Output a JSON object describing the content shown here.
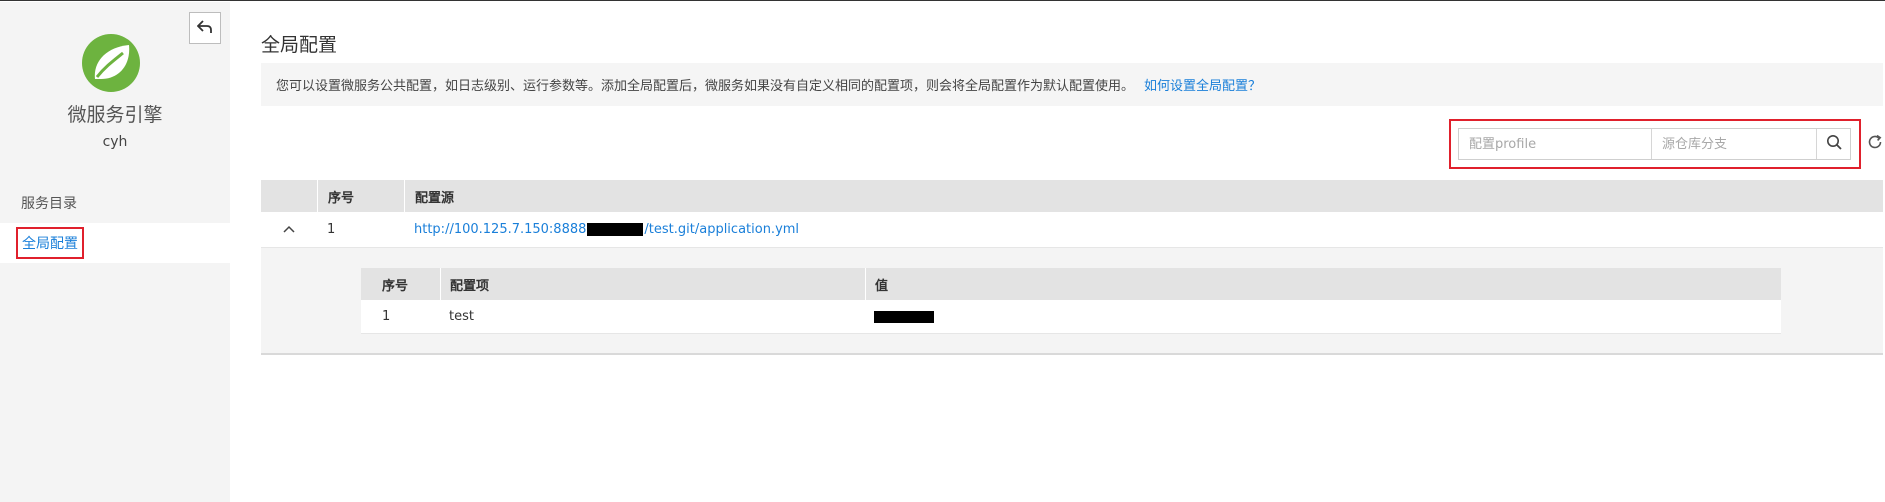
{
  "sidebar": {
    "app_name": "微服务引擎",
    "user": "cyh",
    "nav": [
      {
        "label": "服务目录"
      },
      {
        "label": "全局配置"
      }
    ]
  },
  "main": {
    "title": "全局配置",
    "info_text": "您可以设置微服务公共配置，如日志级别、运行参数等。添加全局配置后，微服务如果没有自定义相同的配置项，则会将全局配置作为默认配置使用。",
    "help_link": "如何设置全局配置？",
    "filter": {
      "profile_placeholder": "配置profile",
      "branch_placeholder": "源仓库分支"
    },
    "table": {
      "headers": [
        "序号",
        "配置源"
      ],
      "rows": [
        {
          "index": "1",
          "source_prefix": "http://100.125.7.150:8888",
          "source_suffix": "/test.git/application.yml"
        }
      ]
    },
    "detail_table": {
      "headers": [
        "序号",
        "配置项",
        "值"
      ],
      "rows": [
        {
          "index": "1",
          "key": "test"
        }
      ]
    }
  },
  "colors": {
    "accent": "#1a7fd9",
    "highlight": "#e0202c",
    "logo": "#6db33f"
  }
}
